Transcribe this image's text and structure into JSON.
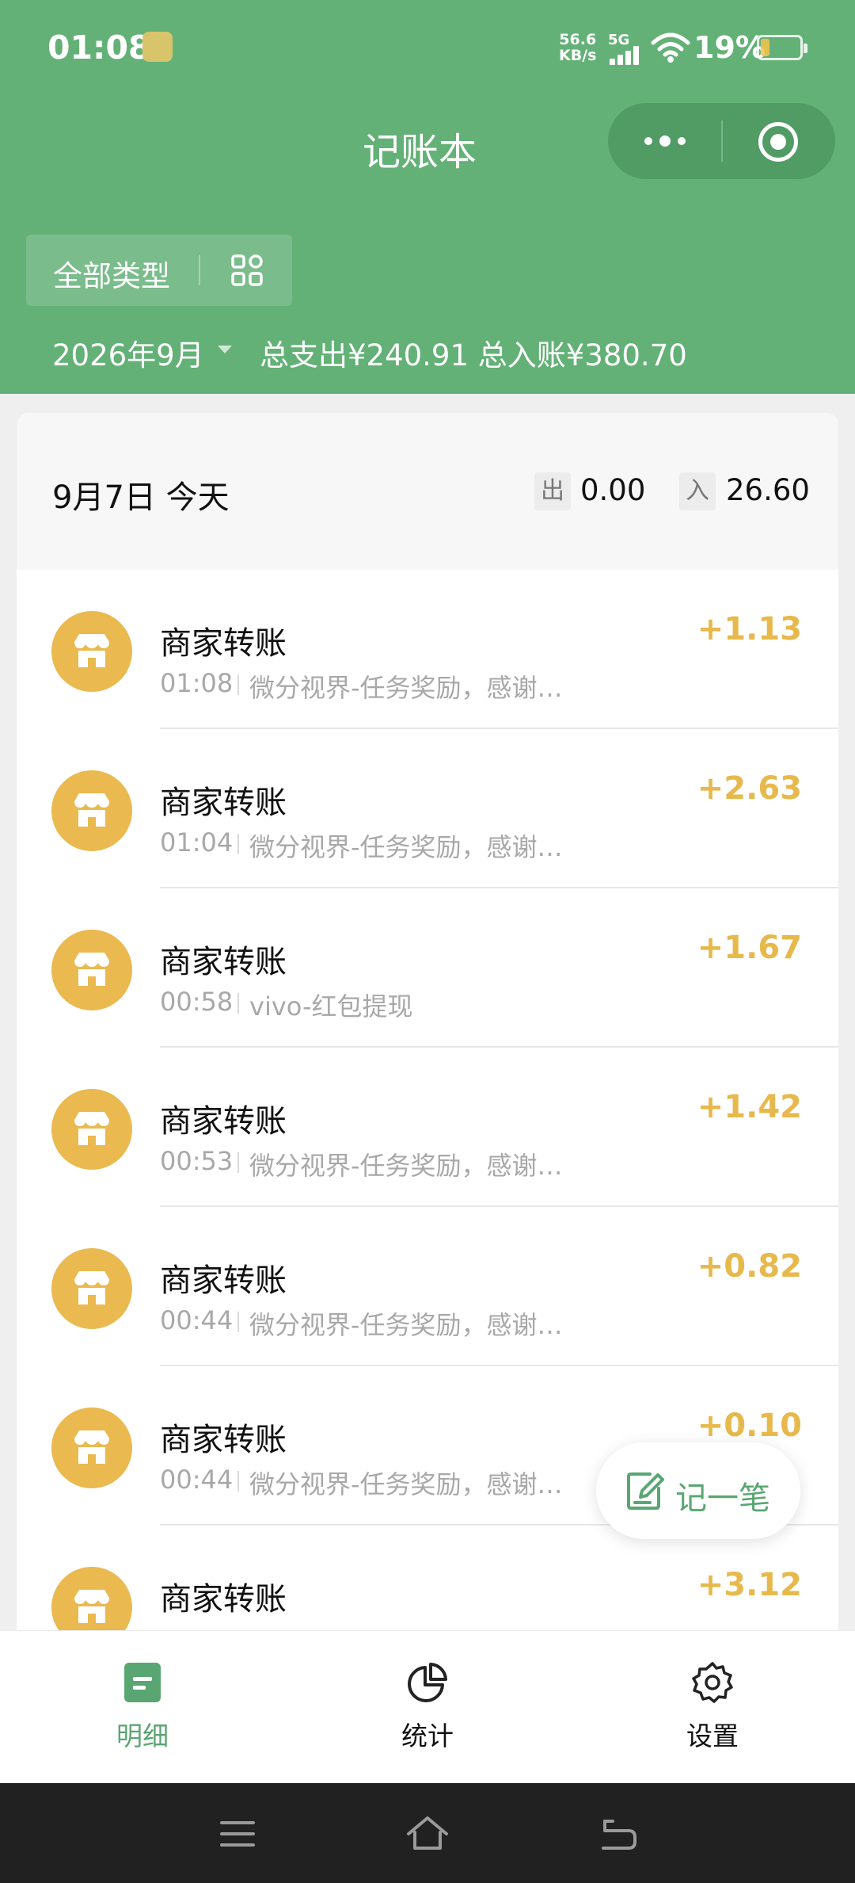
{
  "status_bar": {
    "time": "01:08",
    "net_speed_value": "56.6",
    "net_speed_unit": "KB/s",
    "network": "5G",
    "battery": "19%"
  },
  "app": {
    "title": "记账本"
  },
  "filter": {
    "type_label": "全部类型",
    "month": "2026年9月",
    "totals_text": "总支出¥240.91  总入账¥380.70"
  },
  "day": {
    "title": "9月7日 今天",
    "out_tag": "出",
    "out_value": "0.00",
    "in_tag": "入",
    "in_value": "26.60"
  },
  "transactions": [
    {
      "name": "商家转账",
      "time": "01:08",
      "desc": "微分视界-任务奖励，感谢…",
      "amount": "+1.13"
    },
    {
      "name": "商家转账",
      "time": "01:04",
      "desc": "微分视界-任务奖励，感谢…",
      "amount": "+2.63"
    },
    {
      "name": "商家转账",
      "time": "00:58",
      "desc": "vivo-红包提现",
      "amount": "+1.67"
    },
    {
      "name": "商家转账",
      "time": "00:53",
      "desc": "微分视界-任务奖励，感谢…",
      "amount": "+1.42"
    },
    {
      "name": "商家转账",
      "time": "00:44",
      "desc": "微分视界-任务奖励，感谢…",
      "amount": "+0.82"
    },
    {
      "name": "商家转账",
      "time": "00:44",
      "desc": "微分视界-任务奖励，感谢…",
      "amount": "+0.10"
    },
    {
      "name": "商家转账",
      "time": "",
      "desc": "",
      "amount": "+3.12"
    }
  ],
  "fab": {
    "label": "记一笔",
    "icon": "edit-note-icon"
  },
  "tabs": [
    {
      "label": "明细",
      "icon": "list-document-icon",
      "active": true
    },
    {
      "label": "统计",
      "icon": "pie-chart-icon",
      "active": false
    },
    {
      "label": "设置",
      "icon": "gear-icon",
      "active": false
    }
  ],
  "colors": {
    "header_green": "#63b177",
    "accent_green": "#5aa672",
    "income_gold": "#e7b94c"
  }
}
